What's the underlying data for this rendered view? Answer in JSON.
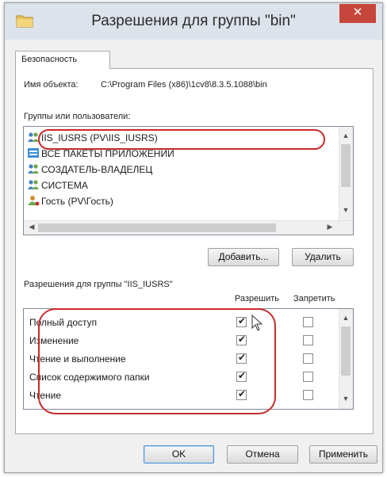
{
  "window": {
    "title": "Разрешения для группы \"bin\"",
    "close_glyph": "✕"
  },
  "tabs": [
    {
      "label": "Безопасность"
    }
  ],
  "object": {
    "label": "Имя объекта:",
    "path": "C:\\Program Files (x86)\\1cv8\\8.3.5.1088\\bin"
  },
  "groups": {
    "label": "Группы или пользователи:",
    "items": [
      {
        "label": "IIS_IUSRS (PV\\IIS_IUSRS)",
        "icon": "users-group-icon",
        "selected": false
      },
      {
        "label": "ВСЕ ПАКЕТЫ ПРИЛОЖЕНИЙ",
        "icon": "app-packages-icon",
        "selected": false
      },
      {
        "label": "СОЗДАТЕЛЬ-ВЛАДЕЛЕЦ",
        "icon": "users-group-icon",
        "selected": false
      },
      {
        "label": "СИСТЕМА",
        "icon": "users-group-icon",
        "selected": false
      },
      {
        "label": "Гость (PV\\Гость)",
        "icon": "user-icon",
        "selected": false
      }
    ],
    "add_label": "Добавить...",
    "remove_label": "Удалить"
  },
  "permissions": {
    "label": "Разрешения для группы \"IIS_IUSRS\"",
    "allow_header": "Разрешить",
    "deny_header": "Запретить",
    "rows": [
      {
        "name": "Полный доступ",
        "allow": true,
        "deny": false
      },
      {
        "name": "Изменение",
        "allow": true,
        "deny": false
      },
      {
        "name": "Чтение и выполнение",
        "allow": true,
        "deny": false
      },
      {
        "name": "Список содержимого папки",
        "allow": true,
        "deny": false
      },
      {
        "name": "Чтение",
        "allow": true,
        "deny": false
      }
    ]
  },
  "buttons": {
    "ok": "OK",
    "cancel": "Отмена",
    "apply": "Применить"
  },
  "colors": {
    "highlight_oval": "#c62b2b",
    "close_button": "#c7463b",
    "titlebar": "#dde3ea"
  }
}
